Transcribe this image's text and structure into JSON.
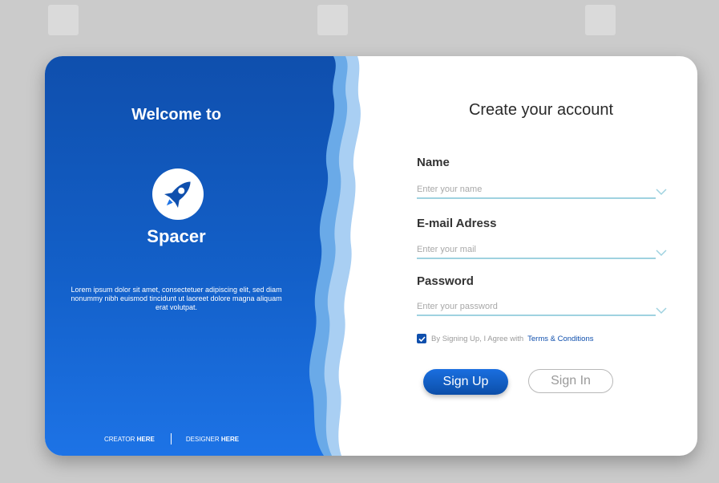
{
  "welcome": {
    "title": "Welcome to",
    "brand": "Spacer",
    "description": "Lorem ipsum dolor sit amet, consectetuer adipiscing elit, sed diam nonummy nibh euismod tincidunt ut laoreet dolore magna aliquam erat volutpat.",
    "logo_icon": "rocket-icon"
  },
  "footer": {
    "creator_prefix": "CREATOR",
    "creator_link": "HERE",
    "designer_prefix": "DESIGNER",
    "designer_link": "HERE"
  },
  "form": {
    "title": "Create your account",
    "name_label": "Name",
    "name_placeholder": "Enter your name",
    "email_label": "E-mail Adress",
    "email_placeholder": "Enter your mail",
    "password_label": "Password",
    "password_placeholder": "Enter your password",
    "terms_text": "By Signing Up, I Agree with",
    "terms_link": "Terms & Conditions",
    "signup_label": "Sign Up",
    "signin_label": "Sign In"
  },
  "colors": {
    "brand_blue": "#0f4fad",
    "input_underline": "#9fd2e0",
    "background": "#cbcbcb"
  }
}
